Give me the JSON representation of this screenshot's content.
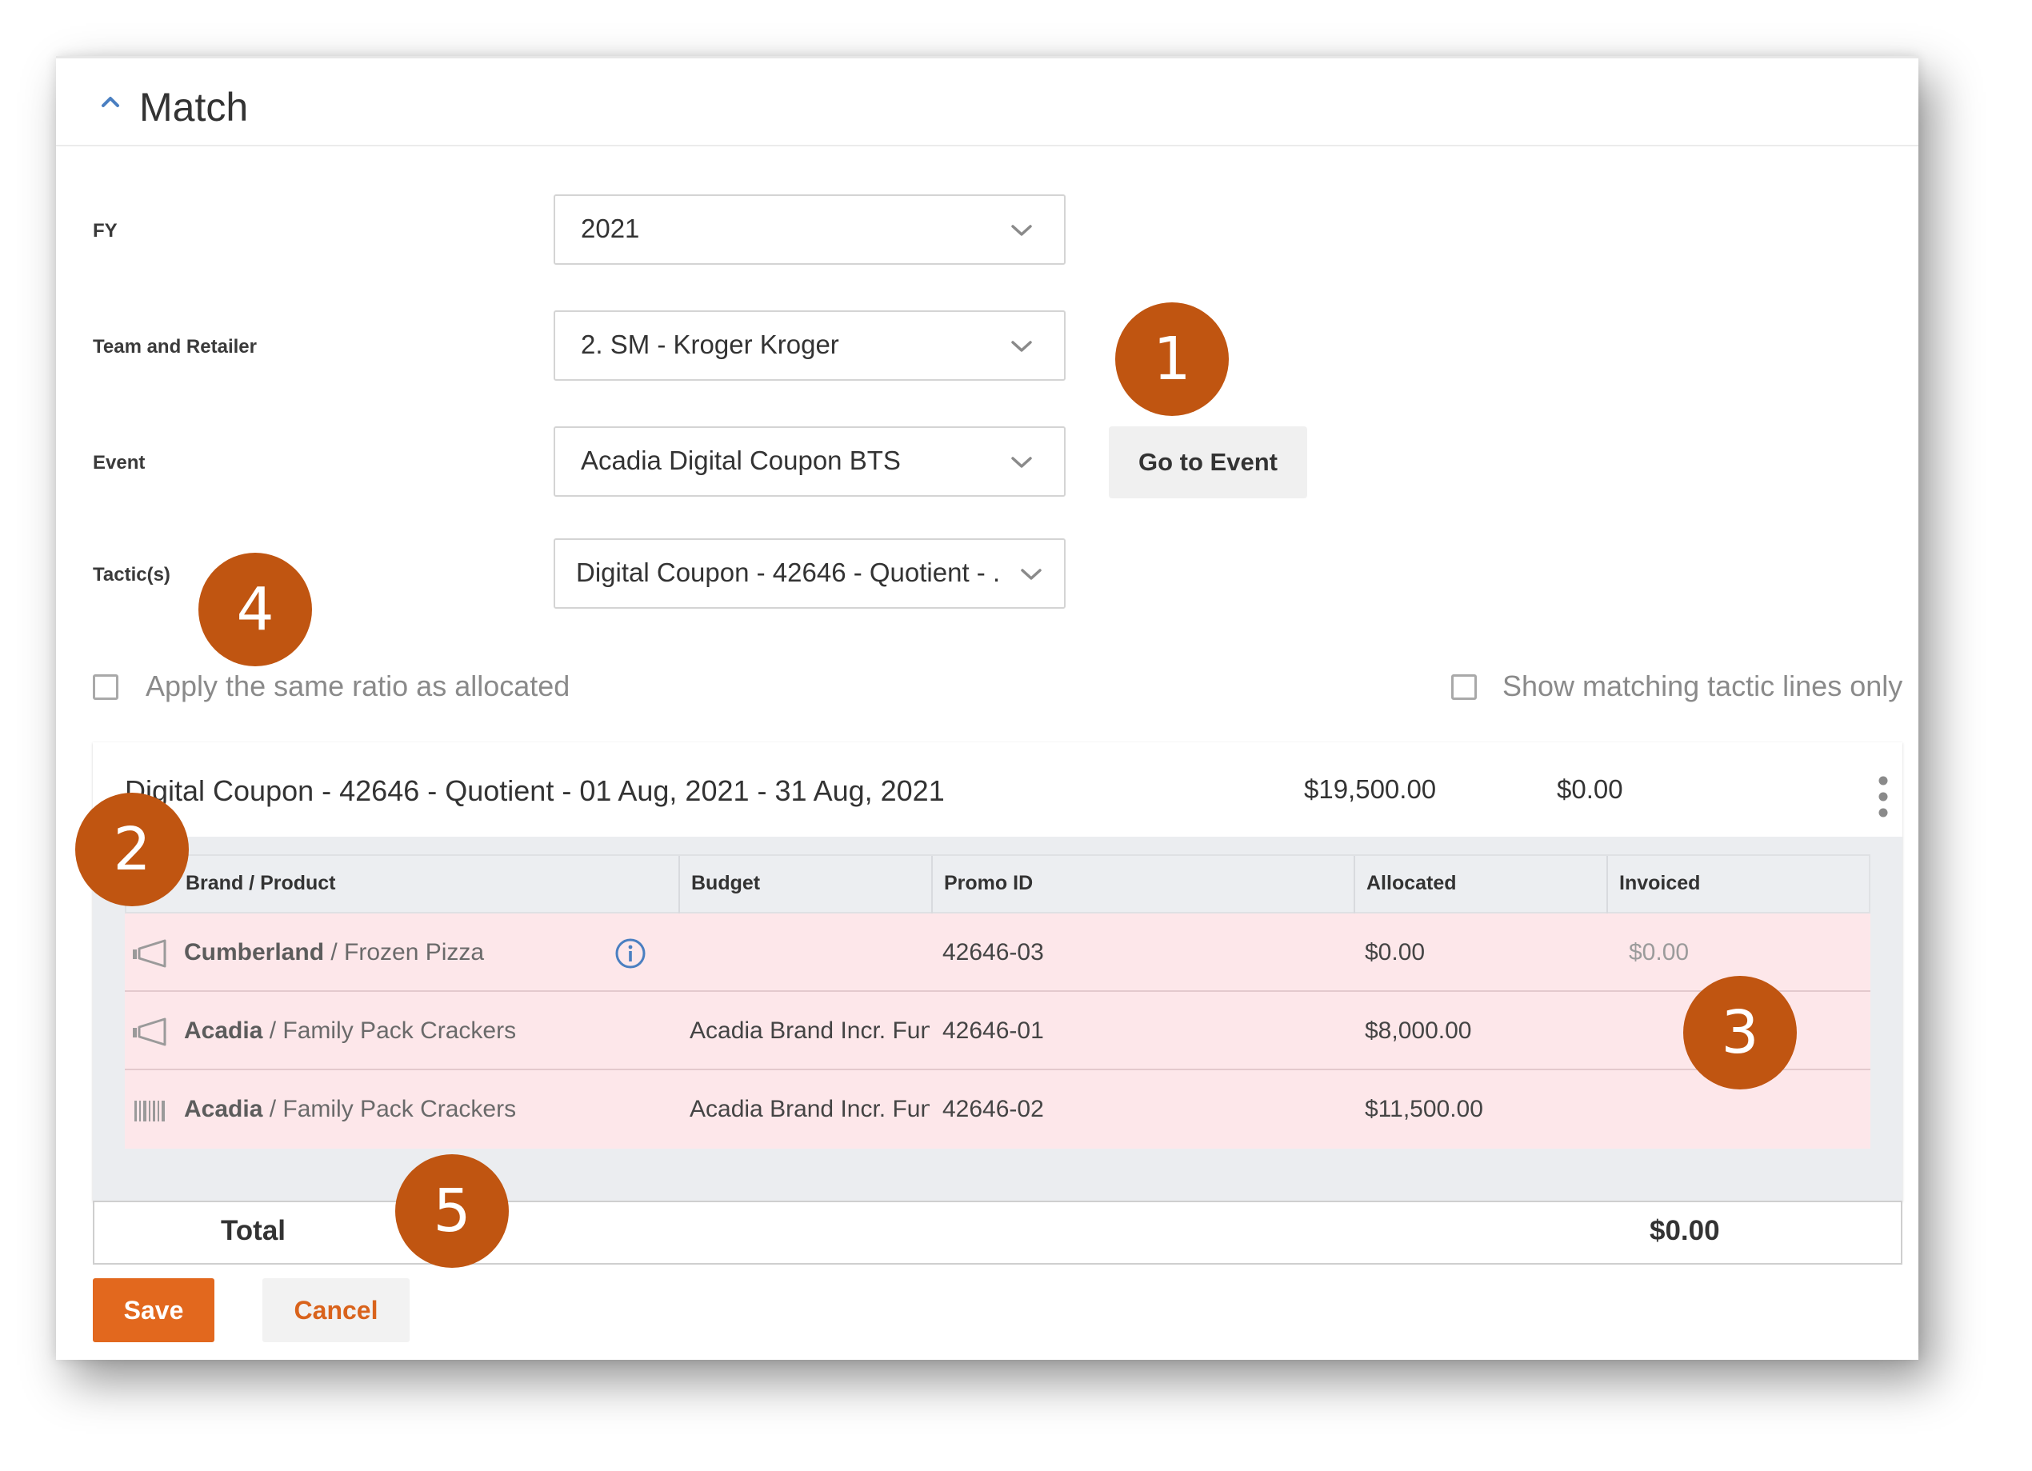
{
  "section": {
    "title": "Match"
  },
  "form": {
    "fy": {
      "label": "FY",
      "value": "2021"
    },
    "team_retailer": {
      "label": "Team and Retailer",
      "value": "2. SM - Kroger Kroger"
    },
    "event": {
      "label": "Event",
      "value": "Acadia Digital Coupon BTS"
    },
    "tactics": {
      "label": "Tactic(s)",
      "value": "Digital Coupon - 42646 - Quotient - ..."
    },
    "go_to_event_label": "Go to Event"
  },
  "options": {
    "apply_ratio": {
      "label": "Apply the same ratio as allocated",
      "checked": false
    },
    "show_matching": {
      "label": "Show matching tactic lines only",
      "checked": false
    }
  },
  "tactic_card": {
    "name": "Digital Coupon - 42646 - Quotient - 01 Aug, 2021 - 31 Aug, 2021",
    "allocated": "$19,500.00",
    "invoiced": "$0.00",
    "columns": [
      "Brand / Product",
      "Budget",
      "Promo ID",
      "Allocated",
      "Invoiced"
    ],
    "rows": [
      {
        "icon": "megaphone-icon",
        "brand": "Cumberland",
        "product": " / Frozen Pizza",
        "has_info": true,
        "budget": "",
        "promo_id": "42646-03",
        "allocated": "$0.00",
        "invoiced": "$0.00"
      },
      {
        "icon": "megaphone-icon",
        "brand": "Acadia",
        "product": " / Family Pack Crackers",
        "has_info": false,
        "budget": "Acadia Brand Incr. Fun",
        "promo_id": "42646-01",
        "allocated": "$8,000.00",
        "invoiced": ""
      },
      {
        "icon": "barcode-icon",
        "brand": "Acadia",
        "product": " / Family Pack Crackers",
        "has_info": false,
        "budget": "Acadia Brand Incr. Fun",
        "promo_id": "42646-02",
        "allocated": "$11,500.00",
        "invoiced": ""
      }
    ]
  },
  "total": {
    "label": "Total",
    "value": "$0.00"
  },
  "actions": {
    "save_label": "Save",
    "cancel_label": "Cancel"
  },
  "callouts": [
    "1",
    "2",
    "3",
    "4",
    "5"
  ],
  "colors": {
    "accent": "#e2681e",
    "callout": "#c05511",
    "row_highlight": "#fde7ea"
  }
}
